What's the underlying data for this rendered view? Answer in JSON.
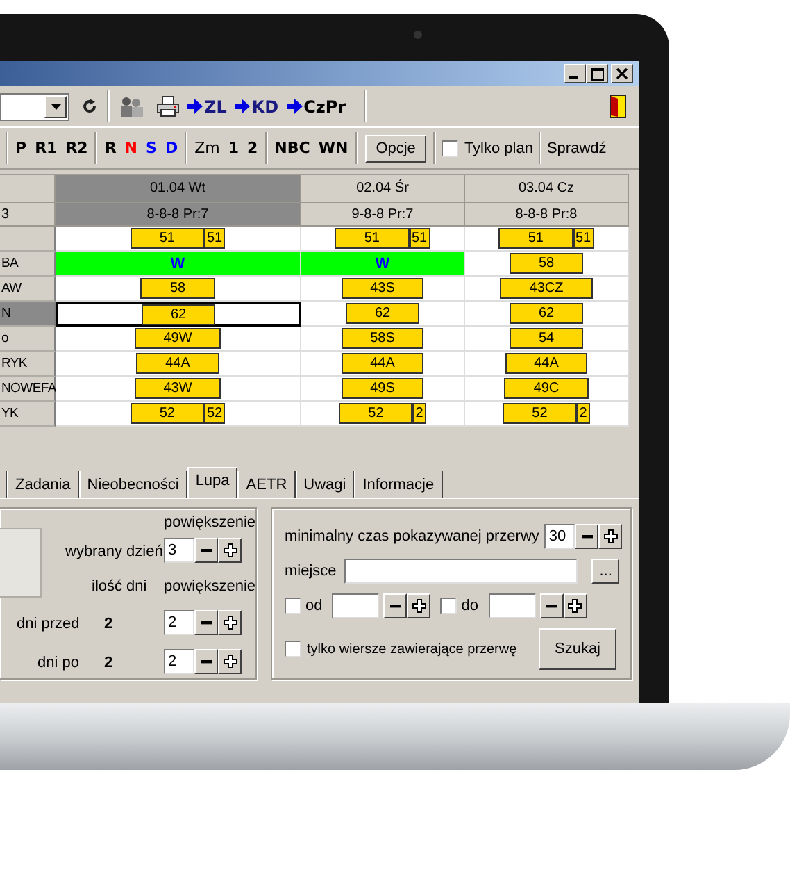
{
  "toolbar": {
    "links": [
      {
        "label": "ZL"
      },
      {
        "label": "KD"
      },
      {
        "label": "CzPr"
      }
    ]
  },
  "filter_bar": {
    "groups": [
      {
        "items": [
          {
            "label": "P"
          },
          {
            "label": "R1"
          },
          {
            "label": "R2"
          }
        ]
      },
      {
        "items": [
          {
            "label": "R",
            "color": "#000000"
          },
          {
            "label": "N",
            "color": "#ff0000"
          },
          {
            "label": "S",
            "color": "#0000ff"
          },
          {
            "label": "D",
            "color": "#0000ff"
          }
        ]
      },
      {
        "items": [
          {
            "label": "Zm"
          },
          {
            "label": "1"
          },
          {
            "label": "2"
          }
        ]
      },
      {
        "items": [
          {
            "label": "NBC"
          },
          {
            "label": "WN"
          }
        ]
      }
    ],
    "options_button": "Opcje",
    "plan_only": {
      "label": "Tylko plan",
      "checked": false
    },
    "check_button": "Sprawdź"
  },
  "schedule": {
    "hours_label": "3",
    "days": [
      {
        "date": "01.04 Wt",
        "hours": "8-8-8 Pr:7",
        "selected": true
      },
      {
        "date": "02.04 Śr",
        "hours": "9-8-8 Pr:7",
        "selected": false
      },
      {
        "date": "03.04 Cz",
        "hours": "8-8-8 Pr:8",
        "selected": false
      }
    ],
    "rows": [
      {
        "name": "",
        "selected": false,
        "cells": [
          {
            "kind": "bars",
            "selected": false,
            "bars": [
              "51",
              "51"
            ]
          },
          {
            "kind": "bars",
            "selected": false,
            "bars": [
              "51",
              "51"
            ]
          },
          {
            "kind": "bars",
            "selected": false,
            "bars": [
              "51",
              "51"
            ]
          }
        ]
      },
      {
        "name": "BA",
        "selected": false,
        "cells": [
          {
            "kind": "leave",
            "selected": false,
            "text": "W"
          },
          {
            "kind": "leave",
            "selected": false,
            "text": "W"
          },
          {
            "kind": "bars",
            "selected": false,
            "bars": [
              "58"
            ]
          }
        ]
      },
      {
        "name": "AW",
        "selected": false,
        "cells": [
          {
            "kind": "bars",
            "selected": false,
            "bars": [
              "58"
            ]
          },
          {
            "kind": "bars",
            "selected": false,
            "bars": [
              "43S"
            ]
          },
          {
            "kind": "bars",
            "selected": false,
            "bars": [
              "43CZ"
            ]
          }
        ]
      },
      {
        "name": "N",
        "selected": true,
        "cells": [
          {
            "kind": "bars",
            "selected": true,
            "bars": [
              "62"
            ]
          },
          {
            "kind": "bars",
            "selected": false,
            "bars": [
              "62"
            ]
          },
          {
            "kind": "bars",
            "selected": false,
            "bars": [
              "62"
            ]
          }
        ]
      },
      {
        "name": "o",
        "selected": false,
        "cells": [
          {
            "kind": "bars",
            "selected": false,
            "bars": [
              "49W"
            ]
          },
          {
            "kind": "bars",
            "selected": false,
            "bars": [
              "58S"
            ]
          },
          {
            "kind": "bars",
            "selected": false,
            "bars": [
              "54"
            ]
          }
        ]
      },
      {
        "name": "RYK",
        "selected": false,
        "cells": [
          {
            "kind": "bars",
            "selected": false,
            "bars": [
              "44A"
            ]
          },
          {
            "kind": "bars",
            "selected": false,
            "bars": [
              "44A"
            ]
          },
          {
            "kind": "bars",
            "selected": false,
            "bars": [
              "44A"
            ]
          }
        ]
      },
      {
        "name": "NOWEFA",
        "selected": false,
        "cells": [
          {
            "kind": "bars",
            "selected": false,
            "bars": [
              "43W"
            ]
          },
          {
            "kind": "bars",
            "selected": false,
            "bars": [
              "49S"
            ]
          },
          {
            "kind": "bars",
            "selected": false,
            "bars": [
              "49C"
            ]
          }
        ]
      },
      {
        "name": "YK",
        "selected": false,
        "cells": [
          {
            "kind": "bars",
            "selected": false,
            "bars": [
              "52",
              "52"
            ]
          },
          {
            "kind": "bars",
            "selected": false,
            "bars": [
              "52",
              "2"
            ]
          },
          {
            "kind": "bars",
            "selected": false,
            "bars": [
              "52",
              "2"
            ]
          }
        ]
      }
    ]
  },
  "tabs": [
    {
      "label": "Zadania",
      "selected": false
    },
    {
      "label": "Nieobecności",
      "selected": false
    },
    {
      "label": "Lupa",
      "selected": true
    },
    {
      "label": "AETR",
      "selected": false
    },
    {
      "label": "Uwagi",
      "selected": false
    },
    {
      "label": "Informacje",
      "selected": false
    }
  ],
  "lupa": {
    "day_zoom_label": "powiększenie",
    "selected_day": {
      "label": "wybrany dzień",
      "value": "3"
    },
    "days_label": "ilość dni",
    "zoom_label": "powiększenie",
    "before": {
      "label": "dni przed",
      "count": "2",
      "zoom": "2"
    },
    "after": {
      "label": "dni po",
      "count": "2",
      "zoom": "2"
    }
  },
  "search": {
    "min_break": {
      "label": "minimalny czas pokazywanej przerwy",
      "value": "30"
    },
    "place": {
      "label": "miejsce",
      "browse": "..."
    },
    "from": {
      "label": "od",
      "checked": false
    },
    "to": {
      "label": "do",
      "checked": false
    },
    "only_breaks": {
      "label": "tylko wiersze zawierające przerwę",
      "checked": false
    },
    "search_button": "Szukaj"
  }
}
